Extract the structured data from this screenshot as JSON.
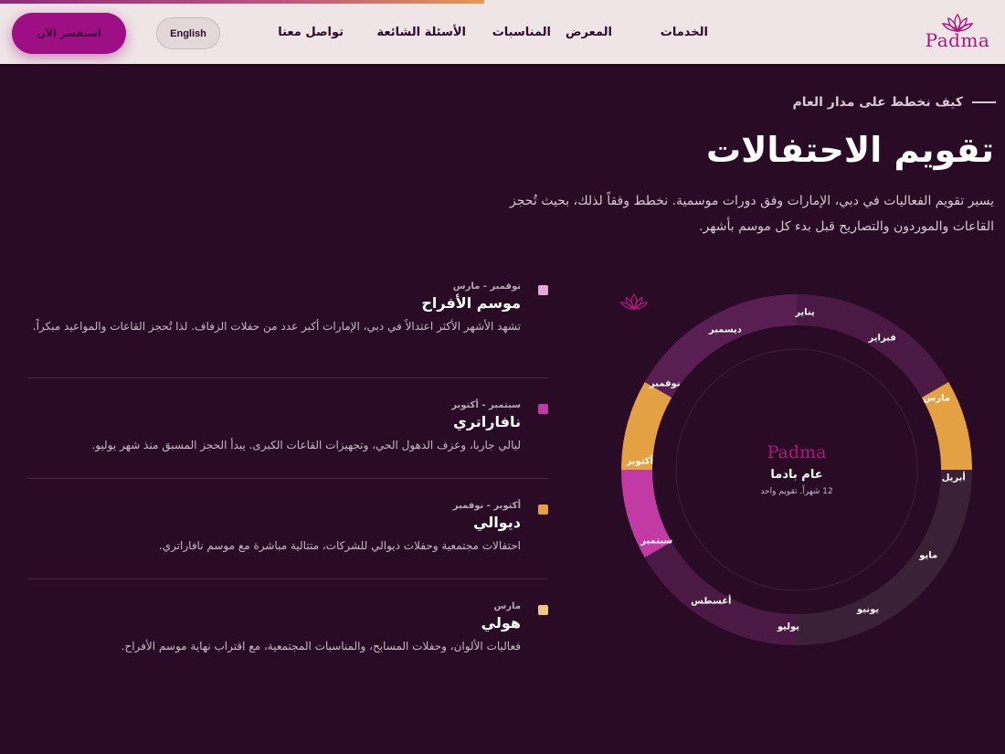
{
  "header": {
    "logo_text": "Padma",
    "nav": [
      "الخدمات",
      "المعرض",
      "المناسبات",
      "الأسئلة الشائعة",
      "تواصل معنا"
    ],
    "language_button": "English",
    "cta_button": "استفسر الآن"
  },
  "section": {
    "eyebrow": "كيف نخطط على مدار العام",
    "title": "تقويم الاحتفالات",
    "lead": "يسير تقويم الفعاليات في دبي، الإمارات وفق دورات موسمية. نخطط وفقاً لذلك، بحيث تُحجز القاعات والموردون والتصاريح قبل بدء كل موسم بأشهر."
  },
  "seasons": [
    {
      "range": "نوفمبر - مارس",
      "name": "موسم الأفراح",
      "desc": "تشهد الأشهر الأكثر اعتدالاً في دبي، الإمارات أكبر عدد من حفلات الزفاف. لذا تُحجز القاعات والمواعيد مبكراً.",
      "color": "#e7a6d8"
    },
    {
      "range": "سبتمبر - أكتوبر",
      "name": "نافاراتري",
      "desc": "ليالي جاربا، وعزف الدهول الحي، وتجهيزات القاعات الكبرى. يبدأ الحجز المسبق منذ شهر يوليو.",
      "color": "#c23aa4"
    },
    {
      "range": "أكتوبر - نوفمبر",
      "name": "ديوالي",
      "desc": "احتفالات مجتمعية وحفلات ديوالي للشركات، متتالية مباشرة مع موسم نافاراتري.",
      "color": "#e3a143"
    },
    {
      "range": "مارس",
      "name": "هولي",
      "desc": "فعاليات الألوان، وحفلات المسابح، والمناسبات المجتمعية، مع اقتراب نهاية موسم الأفراح.",
      "color": "#f0c58a"
    }
  ],
  "wheel": {
    "center_logo": "Padma",
    "center_title": "عام بادما",
    "center_subtitle": "12 شهراً. تقويم واحد",
    "months": [
      "يناير",
      "فبراير",
      "مارس",
      "أبريل",
      "مايو",
      "يونيو",
      "يوليو",
      "أغسطس",
      "سبتمبر",
      "أكتوبر",
      "نوفمبر",
      "ديسمبر"
    ],
    "colors": {
      "wedding": "#5a1f52",
      "wedding_dark": "#4a1944",
      "holi": "#e3a143",
      "off": "#3b2136",
      "summer": "#4a1944",
      "navratri": "#c23aa4",
      "diwali": "#e3a143"
    }
  }
}
